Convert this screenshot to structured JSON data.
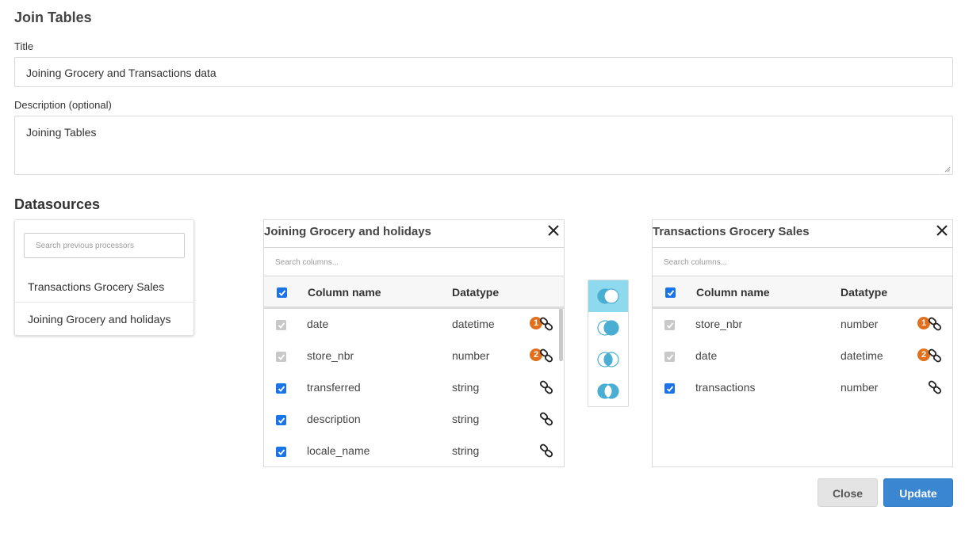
{
  "header": {
    "title": "Join Tables"
  },
  "form": {
    "title_label": "Title",
    "title_value": "Joining Grocery and Transactions data",
    "description_label": "Description (optional)",
    "description_value": "Joining Tables"
  },
  "datasources": {
    "heading": "Datasources",
    "search_placeholder": "Search previous processors",
    "items": [
      {
        "label": "Transactions Grocery Sales"
      },
      {
        "label": "Joining Grocery and holidays"
      }
    ]
  },
  "left_table": {
    "title": "Joining Grocery and holidays",
    "search_placeholder": "Search columns...",
    "col_name_header": "Column name",
    "col_type_header": "Datatype",
    "rows": [
      {
        "name": "date",
        "type": "datetime",
        "badge": "1",
        "checked": true,
        "disabled": true
      },
      {
        "name": "store_nbr",
        "type": "number",
        "badge": "2",
        "checked": true,
        "disabled": true
      },
      {
        "name": "transferred",
        "type": "string",
        "badge": "",
        "checked": true,
        "disabled": false
      },
      {
        "name": "description",
        "type": "string",
        "badge": "",
        "checked": true,
        "disabled": false
      },
      {
        "name": "locale_name",
        "type": "string",
        "badge": "",
        "checked": true,
        "disabled": false
      }
    ]
  },
  "right_table": {
    "title": "Transactions Grocery Sales",
    "search_placeholder": "Search columns...",
    "col_name_header": "Column name",
    "col_type_header": "Datatype",
    "rows": [
      {
        "name": "store_nbr",
        "type": "number",
        "badge": "1",
        "checked": true,
        "disabled": true
      },
      {
        "name": "date",
        "type": "datetime",
        "badge": "2",
        "checked": true,
        "disabled": true
      },
      {
        "name": "transactions",
        "type": "number",
        "badge": "",
        "checked": true,
        "disabled": false
      }
    ]
  },
  "join_types": [
    {
      "icon": "left-join-icon",
      "active": true
    },
    {
      "icon": "right-join-icon",
      "active": false
    },
    {
      "icon": "inner-join-icon",
      "active": false
    },
    {
      "icon": "outer-join-icon",
      "active": false
    }
  ],
  "actions": {
    "close_label": "Close",
    "update_label": "Update"
  },
  "colors": {
    "accent": "#3a86d1",
    "badge": "#e0701c",
    "join_active": "#8fd9ef",
    "join_fill": "#4aaed3",
    "checkbox": "#1a73e8"
  }
}
